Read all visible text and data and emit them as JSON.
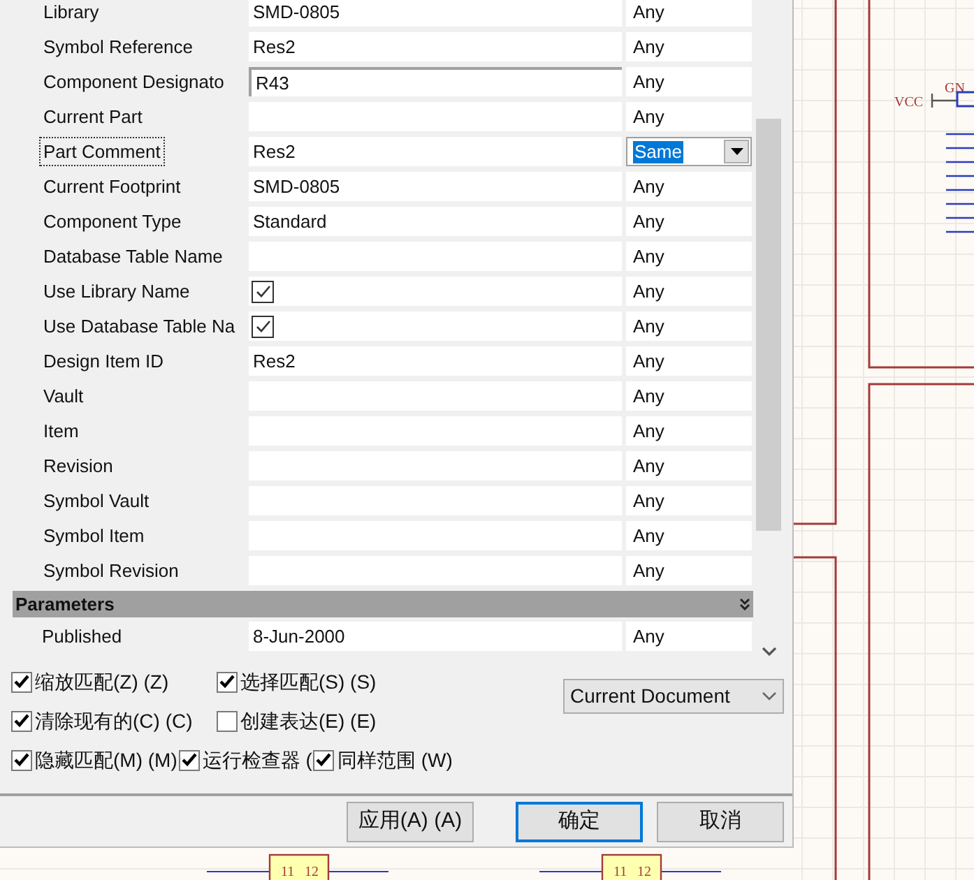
{
  "properties": [
    {
      "label": "Library",
      "value": "SMD-0805",
      "kind": "text",
      "editing": false,
      "focused": false,
      "match": "Any"
    },
    {
      "label": "Symbol Reference",
      "value": "Res2",
      "kind": "text",
      "editing": false,
      "focused": false,
      "match": "Any"
    },
    {
      "label": "Component Designato",
      "value": "R43",
      "kind": "text",
      "editing": true,
      "focused": false,
      "match": "Any"
    },
    {
      "label": "Current Part",
      "kind": "text",
      "editing": false,
      "focused": false,
      "match": "Any"
    },
    {
      "label": "Part Comment",
      "value": "Res2",
      "kind": "text",
      "editing": false,
      "focused": true,
      "match": "Same"
    },
    {
      "label": "Current Footprint",
      "value": "SMD-0805",
      "kind": "text",
      "editing": false,
      "focused": false,
      "match": "Any"
    },
    {
      "label": "Component Type",
      "value": "Standard",
      "kind": "text",
      "editing": false,
      "focused": false,
      "match": "Any"
    },
    {
      "label": "Database Table Name",
      "kind": "text",
      "editing": false,
      "focused": false,
      "match": "Any"
    },
    {
      "label": "Use Library Name",
      "kind": "check",
      "checked": true,
      "editing": false,
      "focused": false,
      "match": "Any"
    },
    {
      "label": "Use Database Table Na",
      "kind": "check",
      "checked": true,
      "editing": false,
      "focused": false,
      "match": "Any"
    },
    {
      "label": "Design Item ID",
      "value": "Res2",
      "kind": "text",
      "editing": false,
      "focused": false,
      "match": "Any"
    },
    {
      "label": "Vault",
      "kind": "text",
      "editing": false,
      "focused": false,
      "match": "Any"
    },
    {
      "label": "Item",
      "kind": "text",
      "editing": false,
      "focused": false,
      "match": "Any"
    },
    {
      "label": "Revision",
      "kind": "text",
      "editing": false,
      "focused": false,
      "match": "Any"
    },
    {
      "label": "Symbol Vault",
      "kind": "text",
      "editing": false,
      "focused": false,
      "match": "Any"
    },
    {
      "label": "Symbol Item",
      "kind": "text",
      "editing": false,
      "focused": false,
      "match": "Any"
    },
    {
      "label": "Symbol Revision",
      "kind": "text",
      "editing": false,
      "focused": false,
      "match": "Any"
    }
  ],
  "parameters": {
    "title": "Parameters",
    "expanded": true,
    "rows": [
      {
        "label": "Published",
        "value": "8-Jun-2000",
        "match": "Any"
      }
    ]
  },
  "options": [
    [
      {
        "label": "缩放匹配(Z) (Z)",
        "checked": true
      },
      {
        "label": "选择匹配(S) (S)",
        "checked": true
      }
    ],
    [
      {
        "label": "清除现有的(C) (C)",
        "checked": true
      },
      {
        "label": "创建表达(E) (E)",
        "checked": false
      }
    ],
    [
      {
        "label": "隐藏匹配(M) (M)",
        "checked": true
      },
      {
        "label": "运行检查器 (",
        "checked": true
      },
      {
        "label": "同样范围 (W)",
        "checked": true
      }
    ]
  ],
  "scope": "Current Document",
  "buttons": [
    {
      "label": "应用(A) (A)",
      "default": false
    },
    {
      "label": "确定",
      "default": true
    },
    {
      "label": "取消",
      "default": false
    }
  ],
  "schematic": {
    "labels": [
      "VCC",
      "GN"
    ],
    "parts": [
      {
        "pins": [
          "11",
          "12"
        ]
      },
      {
        "pins": [
          "11",
          "12"
        ]
      }
    ]
  }
}
